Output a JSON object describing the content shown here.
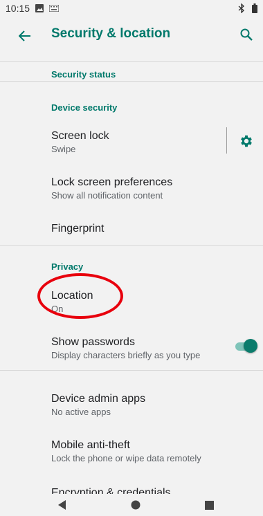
{
  "status_bar": {
    "time": "10:15"
  },
  "app_bar": {
    "title": "Security & location"
  },
  "sections": {
    "security_status": "Security status",
    "device_security": "Device security",
    "privacy": "Privacy"
  },
  "items": {
    "screen_lock": {
      "title": "Screen lock",
      "summary": "Swipe"
    },
    "lock_screen_prefs": {
      "title": "Lock screen preferences",
      "summary": "Show all notification content"
    },
    "fingerprint": {
      "title": "Fingerprint"
    },
    "location": {
      "title": "Location",
      "summary": "On"
    },
    "show_passwords": {
      "title": "Show passwords",
      "summary": "Display characters briefly as you type",
      "toggle_on": true
    },
    "device_admin": {
      "title": "Device admin apps",
      "summary": "No active apps"
    },
    "anti_theft": {
      "title": "Mobile anti-theft",
      "summary": "Lock the phone or wipe data remotely"
    },
    "encryption": {
      "title": "Encryption & credentials"
    }
  },
  "colors": {
    "accent": "#00796b",
    "annotation": "#e8000d",
    "background": "#f2f2f2"
  },
  "icons": {
    "back": "arrow-back-icon",
    "search": "search-icon",
    "settings": "gear-icon"
  }
}
